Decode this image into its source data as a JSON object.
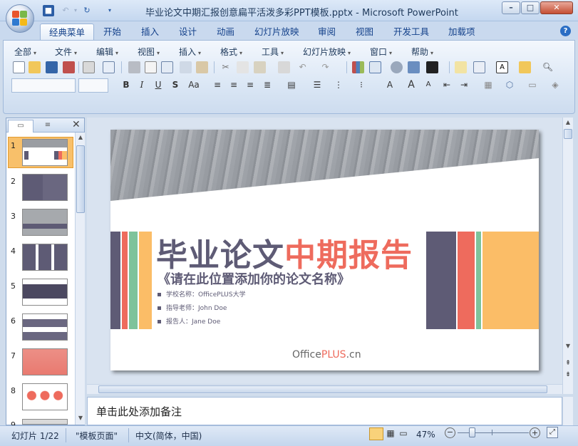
{
  "window": {
    "title": "毕业论文中期汇报创意扁平活泼多彩PPT模板.pptx - Microsoft PowerPoint",
    "minimize": "–",
    "maximize": "□",
    "close": "✕"
  },
  "tabs": [
    "经典菜单",
    "开始",
    "插入",
    "设计",
    "动画",
    "幻灯片放映",
    "审阅",
    "视图",
    "开发工具",
    "加载项"
  ],
  "menus": [
    "全部",
    "文件",
    "编辑",
    "视图",
    "插入",
    "格式",
    "工具",
    "幻灯片放映",
    "窗口",
    "帮助"
  ],
  "format_buttons": {
    "bold": "B",
    "italic": "I",
    "underline": "U",
    "shadow": "S",
    "case": "Aa"
  },
  "font_size_buttons": {
    "grow": "A",
    "shrink": "A"
  },
  "slide_numbers": [
    "1",
    "2",
    "3",
    "4",
    "5",
    "6",
    "7",
    "8",
    "9"
  ],
  "slide": {
    "title_part1": "毕业论文",
    "title_part2": "中期报告",
    "subtitle": "《请在此位置添加你的论文名称》",
    "info": [
      "学校名称：OfficePLUS大学",
      "指导老师：John Doe",
      "报告人：Jane Doe"
    ],
    "logo_office": "Office",
    "logo_plus": "PLUS",
    "logo_cn": ".cn",
    "colors": {
      "purple": "#5e5b75",
      "coral": "#ee6b5d",
      "green": "#7ec39b",
      "yellow": "#fbbd67"
    }
  },
  "notes_placeholder": "单击此处添加备注",
  "status": {
    "slide_info": "幻灯片 1/22",
    "theme": "\"模板页面\"",
    "language": "中文(简体，中国)",
    "zoom": "47%"
  }
}
